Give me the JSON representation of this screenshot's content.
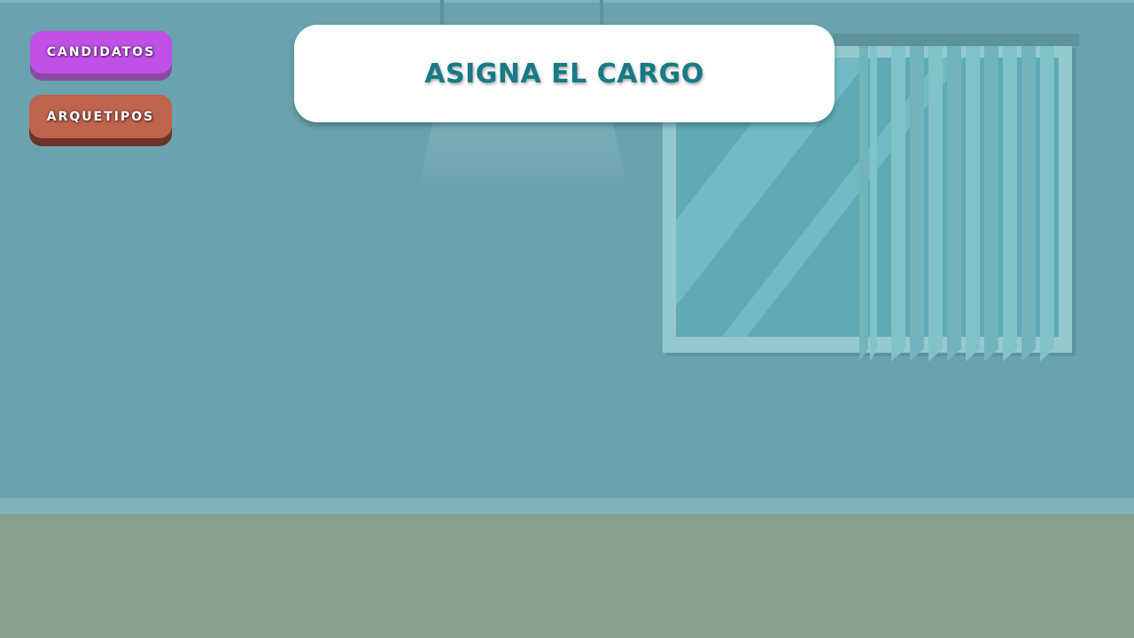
{
  "title": "ASIGNA EL CARGO",
  "buttons": {
    "candidatos": "CANDIDATOS",
    "arquetipos": "ARQUETIPOS"
  },
  "colors": {
    "wall": "#6aa2ad",
    "floor": "#88a090",
    "candidatos_button": "#c050e8",
    "arquetipos_button": "#c06450",
    "title_text": "#177a86"
  }
}
